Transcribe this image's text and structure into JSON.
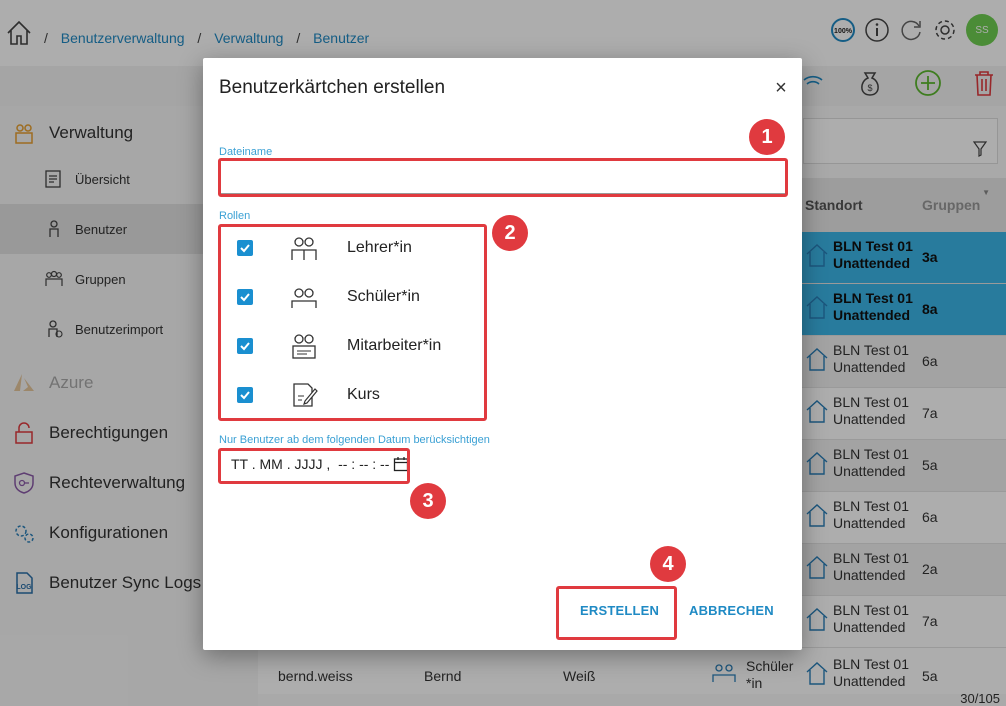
{
  "breadcrumb": {
    "sep": "/",
    "items": [
      "Benutzerverwaltung",
      "Verwaltung",
      "Benutzer"
    ]
  },
  "topbar": {
    "zoom": "100%",
    "avatar": "SS"
  },
  "sidebar": {
    "main1": "Verwaltung",
    "sub": [
      "Übersicht",
      "Benutzer",
      "Gruppen",
      "Benutzerimport"
    ],
    "main2": [
      "Azure",
      "Berechtigungen",
      "Rechteverwaltung",
      "Konfigurationen",
      "Benutzer Sync Logs"
    ]
  },
  "table": {
    "headers": {
      "location": "Standort",
      "groups": "Gruppen"
    },
    "rows": [
      {
        "loc1": "BLN Test 01",
        "loc2": "Unattended",
        "group": "3a"
      },
      {
        "loc1": "BLN Test 01",
        "loc2": "Unattended",
        "group": "8a"
      },
      {
        "loc1": "BLN Test 01",
        "loc2": "Unattended",
        "group": "6a"
      },
      {
        "loc1": "BLN Test 01",
        "loc2": "Unattended",
        "group": "7a"
      },
      {
        "loc1": "BLN Test 01",
        "loc2": "Unattended",
        "group": "5a"
      },
      {
        "loc1": "BLN Test 01",
        "loc2": "Unattended",
        "group": "6a"
      },
      {
        "loc1": "BLN Test 01",
        "loc2": "Unattended",
        "group": "2a"
      },
      {
        "loc1": "BLN Test 01",
        "loc2": "Unattended",
        "group": "7a"
      }
    ],
    "last_row": {
      "username": "bernd.weiss",
      "firstname": "Bernd",
      "lastname": "Weiß",
      "role1": "Schüler",
      "role2": "*in",
      "loc1": "BLN Test 01",
      "loc2": "Unattended",
      "group": "5a"
    },
    "page_count": "30/105"
  },
  "dialog": {
    "title": "Benutzerkärtchen erstellen",
    "close": "×",
    "filename_label": "Dateiname",
    "filename_value": "",
    "roles_label": "Rollen",
    "roles": [
      "Lehrer*in",
      "Schüler*in",
      "Mitarbeiter*in",
      "Kurs"
    ],
    "date_label": "Nur Benutzer ab dem folgenden Datum berücksichtigen",
    "date_placeholder": "TT . MM . JJJJ ,  -- : -- : --",
    "create_button": "ERSTELLEN",
    "cancel_button": "ABBRECHEN"
  },
  "annotations": [
    "1",
    "2",
    "3",
    "4"
  ],
  "colors": {
    "accent": "#1f8ac4",
    "highlight": "#e03a3f",
    "selected_row": "#3cb6e8",
    "avatar": "#6fcf52"
  }
}
